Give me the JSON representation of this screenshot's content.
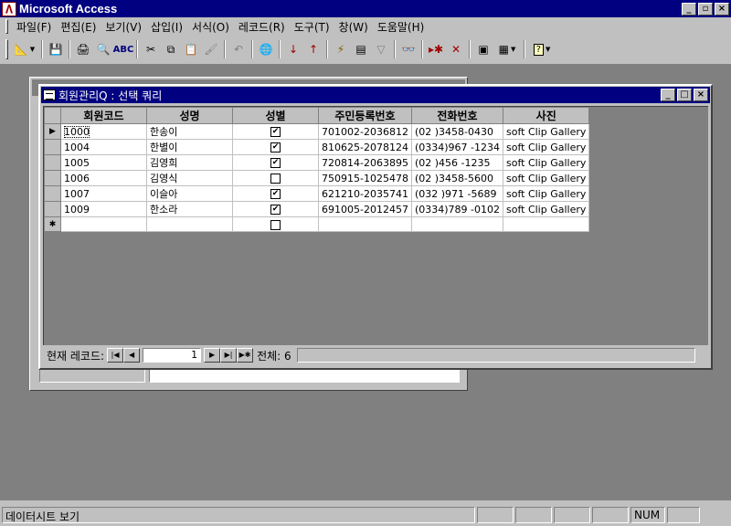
{
  "app": {
    "title": "Microsoft Access"
  },
  "window_buttons": {
    "minimize": "_",
    "restore": "▫",
    "close": "×"
  },
  "menu": [
    "파일(F)",
    "편집(E)",
    "보기(V)",
    "삽입(I)",
    "서식(O)",
    "레코드(R)",
    "도구(T)",
    "창(W)",
    "도움말(H)"
  ],
  "query": {
    "title": "회원관리Q : 선택 쿼리",
    "columns": [
      "회원코드",
      "성명",
      "성별",
      "주민등록번호",
      "전화번호",
      "사진"
    ],
    "rows": [
      {
        "code": "1000",
        "name": "한송이",
        "sex": true,
        "jumin": "701002-2036812",
        "phone": "(02  )3458-0430",
        "photo": "soft Clip Gallery"
      },
      {
        "code": "1004",
        "name": "한별이",
        "sex": true,
        "jumin": "810625-2078124",
        "phone": "(0334)967 -1234",
        "photo": "soft Clip Gallery"
      },
      {
        "code": "1005",
        "name": "김영희",
        "sex": true,
        "jumin": "720814-2063895",
        "phone": "(02  )456 -1235",
        "photo": "soft Clip Gallery"
      },
      {
        "code": "1006",
        "name": "김영식",
        "sex": false,
        "jumin": "750915-1025478",
        "phone": "(02  )3458-5600",
        "photo": "soft Clip Gallery"
      },
      {
        "code": "1007",
        "name": "이슬아",
        "sex": true,
        "jumin": "621210-2035741",
        "phone": "(032 )971 -5689",
        "photo": "soft Clip Gallery"
      },
      {
        "code": "1009",
        "name": "한소라",
        "sex": true,
        "jumin": "691005-2012457",
        "phone": "(0334)789 -0102",
        "photo": "soft Clip Gallery"
      }
    ],
    "nav": {
      "label": "현재 레코드:",
      "current": "1",
      "total_label": "전체: 6"
    }
  },
  "status": {
    "text": "데이터시트 보기",
    "num": "NUM"
  },
  "colors": {
    "titlebar": "#000080",
    "face": "#c0c0c0",
    "mdi": "#808080"
  }
}
